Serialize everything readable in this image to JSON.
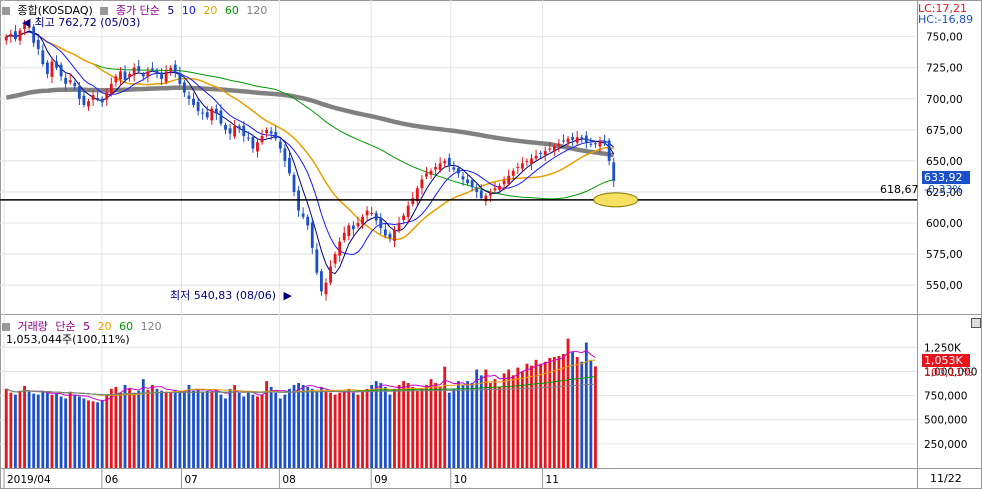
{
  "price_panel": {
    "symbol_label": "종합(KOSDAQ)",
    "ma_label": "종가 단순",
    "ma_periods": [
      "5",
      "10",
      "20",
      "60",
      "120"
    ],
    "ma_colors": {
      "5": "#000080",
      "10": "#1a1aff",
      "20": "#e8a000",
      "60": "#009900",
      "120": "#808080"
    },
    "high_note": "최고 762,72 (05/03)",
    "low_note": "최저 540,83 (08/06)",
    "lc": "LC:17,21",
    "hc": "HC:-16,89",
    "current_price": "633,92",
    "current_change": "-0,33%",
    "ref_line_label": "618,67",
    "price_ticks": [
      "750,00",
      "725,00",
      "700,00",
      "675,00",
      "650,00",
      "625,00",
      "600,00",
      "575,00",
      "550,00"
    ]
  },
  "volume_panel": {
    "title": "거래량",
    "ma_label": "단순",
    "ma_periods": [
      "5",
      "20",
      "60",
      "120"
    ],
    "current_volume": "1,053,044주(100,11%)",
    "current_badge": "1,053K",
    "current_pct": "100,11%",
    "volume_ticks": [
      "1,250K",
      "1,000,000",
      "750,000",
      "500,000",
      "250,000"
    ]
  },
  "x_axis": {
    "labels": [
      "2019/04",
      "06",
      "07",
      "08",
      "09",
      "10",
      "11"
    ],
    "end_label": "11/22"
  },
  "colors": {
    "up": "#e8141c",
    "down": "#1c50c8",
    "current_badge": "#e8141c",
    "ref_line": "#000000",
    "ellipse": "#f5e060"
  },
  "chart_data": {
    "type": "candlestick",
    "title": "종합(KOSDAQ)",
    "ylim": [
      530,
      765
    ],
    "volume_ylim": [
      0,
      1450000
    ],
    "reference_line": 618.67,
    "high": {
      "value": 762.72,
      "date": "05/03"
    },
    "low": {
      "value": 540.83,
      "date": "08/06"
    },
    "close_series": [
      750,
      752,
      748,
      755,
      760,
      758,
      745,
      740,
      728,
      720,
      730,
      725,
      718,
      712,
      715,
      710,
      700,
      695,
      698,
      703,
      700,
      697,
      705,
      712,
      718,
      722,
      715,
      720,
      725,
      722,
      718,
      722,
      724,
      720,
      716,
      722,
      725,
      722,
      712,
      705,
      700,
      695,
      690,
      688,
      685,
      692,
      688,
      680,
      675,
      672,
      678,
      676,
      670,
      668,
      660,
      665,
      670,
      675,
      672,
      668,
      660,
      650,
      640,
      625,
      610,
      605,
      598,
      580,
      560,
      545,
      552,
      565,
      575,
      585,
      592,
      598,
      595,
      600,
      605,
      610,
      608,
      602,
      596,
      590,
      588,
      594,
      600,
      606,
      614,
      620,
      628,
      635,
      640,
      642,
      645,
      648,
      650,
      646,
      643,
      640,
      635,
      632,
      629,
      625,
      620,
      622,
      624,
      628,
      630,
      634,
      638,
      642,
      645,
      648,
      650,
      652,
      654,
      656,
      658,
      660,
      662,
      664,
      666,
      668,
      667,
      669,
      668,
      665,
      663,
      664,
      666,
      664,
      650,
      634
    ],
    "volume_series": [
      820000,
      780000,
      760000,
      800000,
      850000,
      790000,
      770000,
      760000,
      800000,
      780000,
      760000,
      770000,
      740000,
      720000,
      790000,
      760000,
      740000,
      720000,
      700000,
      690000,
      680000,
      700000,
      760000,
      820000,
      840000,
      780000,
      860000,
      820000,
      780000,
      800000,
      920000,
      810000,
      860000,
      820000,
      800000,
      790000,
      780000,
      810000,
      800000,
      780000,
      860000,
      800000,
      820000,
      780000,
      800000,
      790000,
      810000,
      760000,
      720000,
      820000,
      860000,
      780000,
      740000,
      780000,
      760000,
      740000,
      760000,
      900000,
      840000,
      780000,
      720000,
      760000,
      820000,
      860000,
      880000,
      860000,
      840000,
      820000,
      790000,
      840000,
      800000,
      780000,
      760000,
      780000,
      800000,
      820000,
      780000,
      760000,
      800000,
      820000,
      860000,
      900000,
      880000,
      840000,
      760000,
      820000,
      860000,
      900000,
      880000,
      840000,
      800000,
      820000,
      860000,
      920000,
      880000,
      840000,
      1050000,
      780000,
      820000,
      900000,
      860000,
      900000,
      880000,
      1020000,
      960000,
      1020000,
      880000,
      920000,
      840000,
      980000,
      1020000,
      960000,
      1040000,
      1000000,
      1080000,
      1060000,
      1120000,
      1080000,
      1100000,
      1140000,
      1150000,
      1160000,
      1180000,
      1340000,
      1200000,
      1150000,
      1100000,
      1300000,
      1120000,
      1053044
    ]
  }
}
